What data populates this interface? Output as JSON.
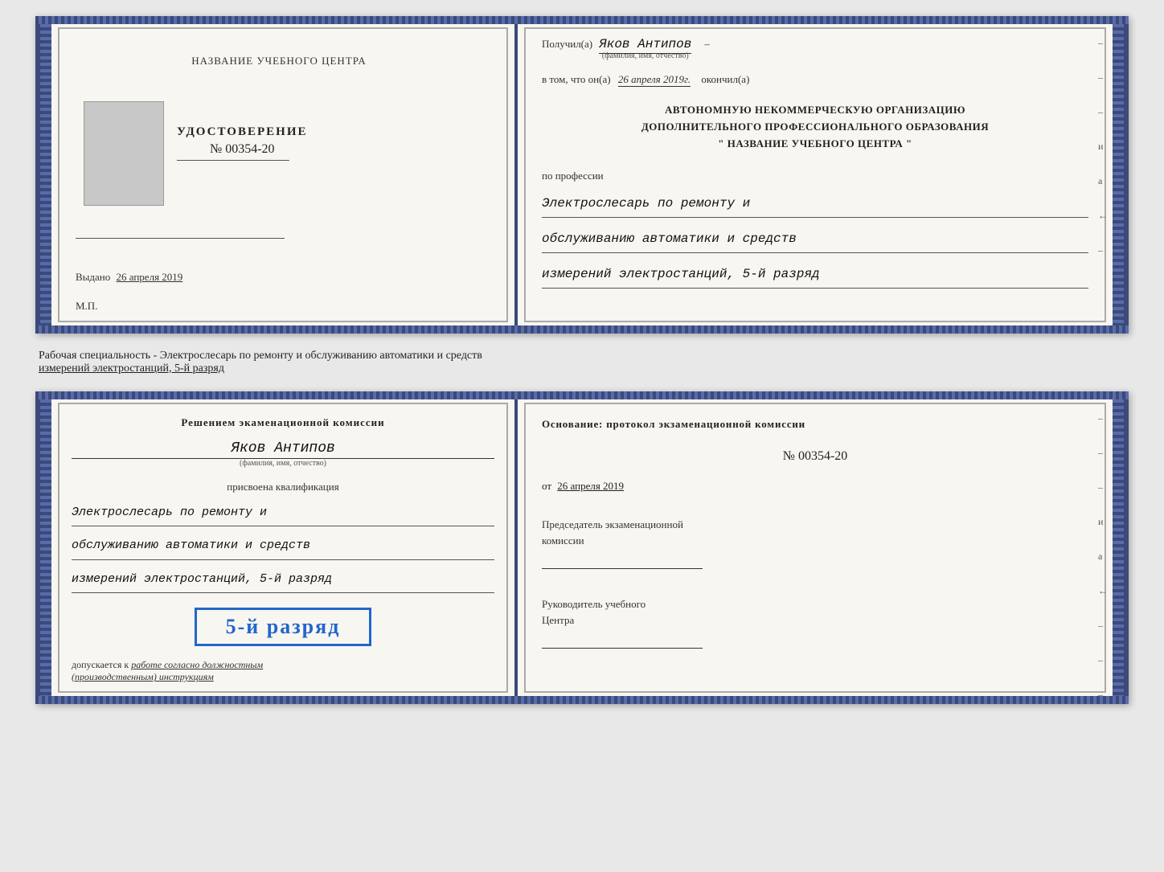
{
  "topDoc": {
    "leftPage": {
      "schoolLabel": "НАЗВАНИЕ УЧЕБНОГО ЦЕНТРА",
      "certTitle": "УДОСТОВЕРЕНИЕ",
      "certNumber": "№ 00354-20",
      "issuedLabel": "Выдано",
      "issuedDate": "26 апреля 2019",
      "mpLabel": "М.П."
    },
    "rightPage": {
      "receivedLabel": "Получил(а)",
      "recipientName": "Яков Антипов",
      "fioSubtitle": "(фамилия, имя, отчество)",
      "certifiedLabel": "в том, что он(а)",
      "certifiedDate": "26 апреля 2019г.",
      "completedLabel": "окончил(а)",
      "orgLine1": "АВТОНОМНУЮ НЕКОММЕРЧЕСКУЮ ОРГАНИЗАЦИЮ",
      "orgLine2": "ДОПОЛНИТЕЛЬНОГО ПРОФЕССИОНАЛЬНОГО ОБРАЗОВАНИЯ",
      "orgLine3": "\" НАЗВАНИЕ УЧЕБНОГО ЦЕНТРА \"",
      "professionLabel": "по профессии",
      "professionLine1": "Электрослесарь по ремонту и",
      "professionLine2": "обслуживанию автоматики и средств",
      "professionLine3": "измерений электростанций, 5-й разряд",
      "sideMarks": [
        "-",
        "-",
        "-",
        "и",
        "а",
        "←",
        "-"
      ]
    }
  },
  "middleText": {
    "line1": "Рабочая специальность - Электрослесарь по ремонту и обслуживанию автоматики и средств",
    "line2": "измерений электростанций, 5-й разряд"
  },
  "bottomDoc": {
    "leftPage": {
      "decisionText": "Решением экаменационной комиссии",
      "personName": "Яков Антипов",
      "fioSubtitle": "(фамилия, имя, отчество)",
      "qualificationLabel": "присвоена квалификация",
      "qualLine1": "Электрослесарь по ремонту и",
      "qualLine2": "обслуживанию автоматики и средств",
      "qualLine3": "измерений электростанций, 5-й разряд",
      "rankBadge": "5-й разряд",
      "допускLabel": "допускается к",
      "допускText": "работе согласно должностным",
      "допускText2": "(производственным) инструкциям"
    },
    "rightPage": {
      "basisLabel": "Основание: протокол экзаменационной комиссии",
      "protocolNumber": "№ 00354-20",
      "protocolDatePrefix": "от",
      "protocolDate": "26 апреля 2019",
      "chairmanLabel": "Председатель экзаменационной",
      "chairmanLabel2": "комиссии",
      "directorLabel": "Руководитель учебного",
      "directorLabel2": "Центра",
      "sideMarks": [
        "-",
        "-",
        "-",
        "и",
        "а",
        "←",
        "-",
        "-",
        "-"
      ]
    }
  }
}
